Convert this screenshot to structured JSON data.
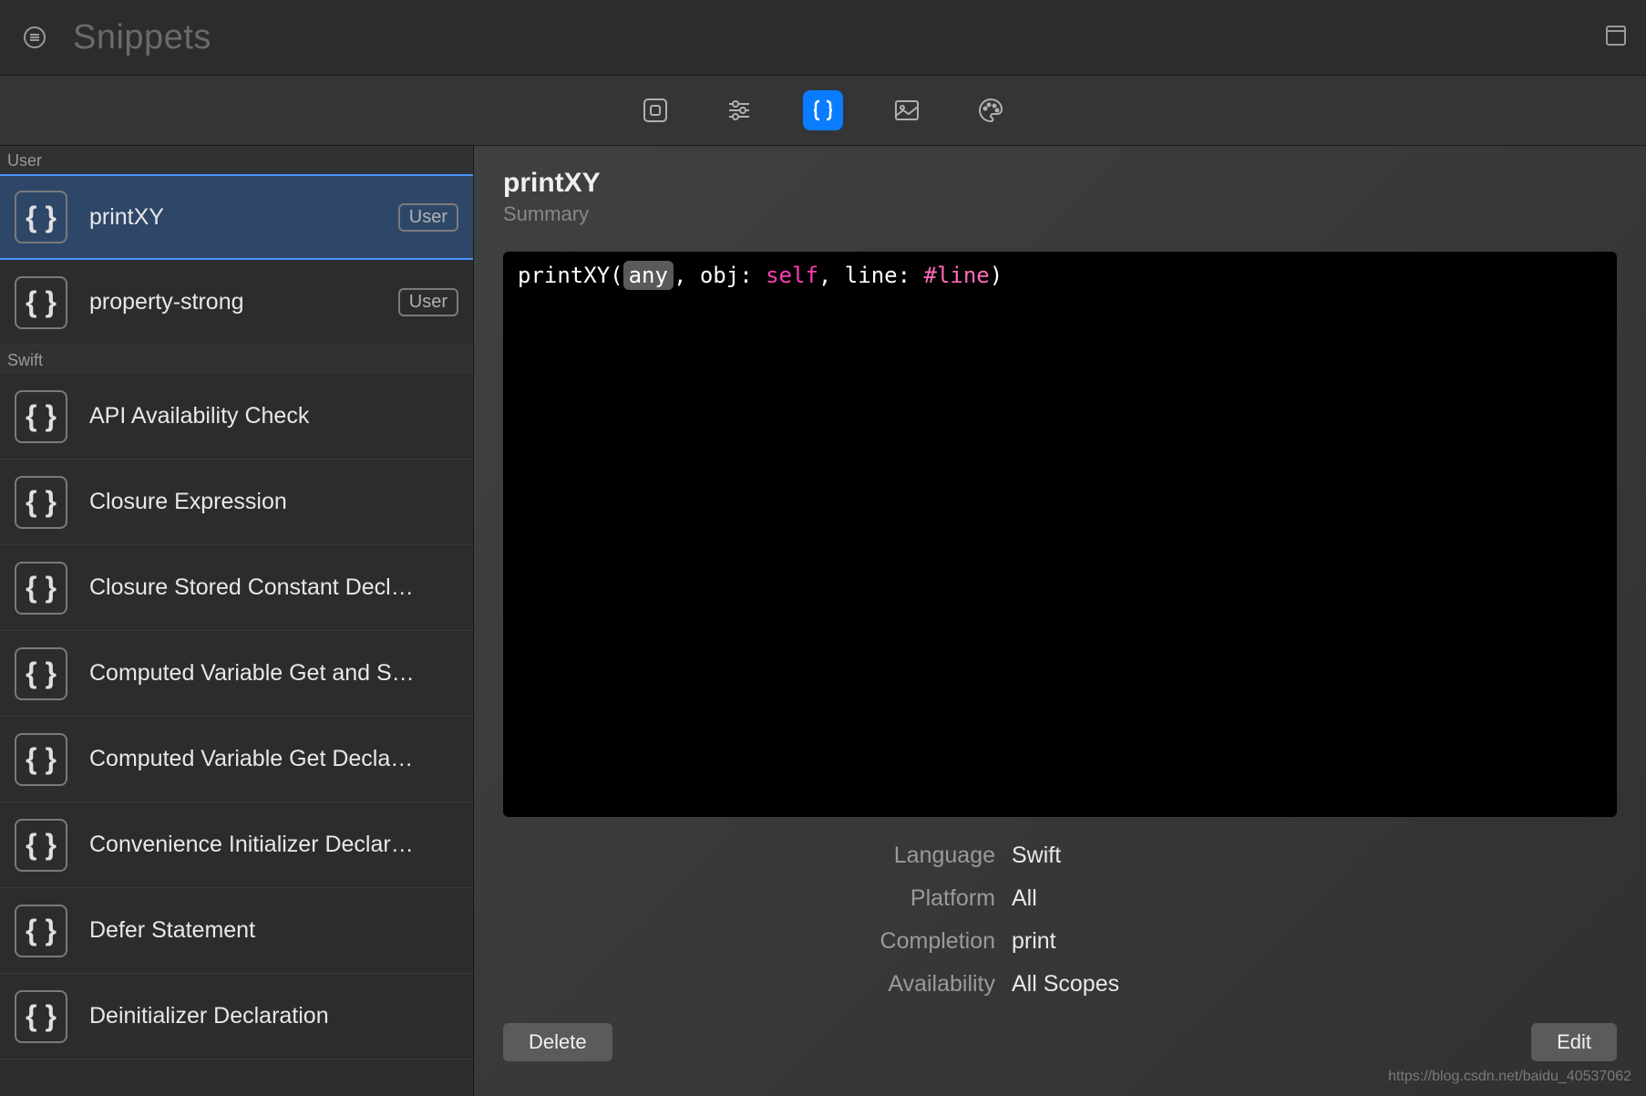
{
  "header": {
    "title_placeholder": "Snippets"
  },
  "sidebar": {
    "sections": [
      {
        "header": "User",
        "items": [
          {
            "label": "printXY",
            "badge": "User",
            "selected": true
          },
          {
            "label": "property-strong",
            "badge": "User",
            "selected": false
          }
        ]
      },
      {
        "header": "Swift",
        "items": [
          {
            "label": "API Availability Check"
          },
          {
            "label": "Closure Expression"
          },
          {
            "label": "Closure Stored Constant Decl…"
          },
          {
            "label": "Computed Variable Get and S…"
          },
          {
            "label": "Computed Variable Get Decla…"
          },
          {
            "label": "Convenience Initializer Declar…"
          },
          {
            "label": "Defer Statement"
          },
          {
            "label": "Deinitializer Declaration"
          }
        ]
      }
    ]
  },
  "detail": {
    "title": "printXY",
    "subtitle": "Summary",
    "code": {
      "prefix": "printXY(",
      "any": "any",
      "mid1": ", obj: ",
      "self": "self",
      "mid2": ", line: ",
      "line": "#line",
      "suffix": ")"
    },
    "meta": {
      "language_label": "Language",
      "language_value": "Swift",
      "platform_label": "Platform",
      "platform_value": "All",
      "completion_label": "Completion",
      "completion_value": "print",
      "availability_label": "Availability",
      "availability_value": "All Scopes"
    },
    "delete_label": "Delete",
    "edit_label": "Edit"
  },
  "watermark": "https://blog.csdn.net/baidu_40537062"
}
